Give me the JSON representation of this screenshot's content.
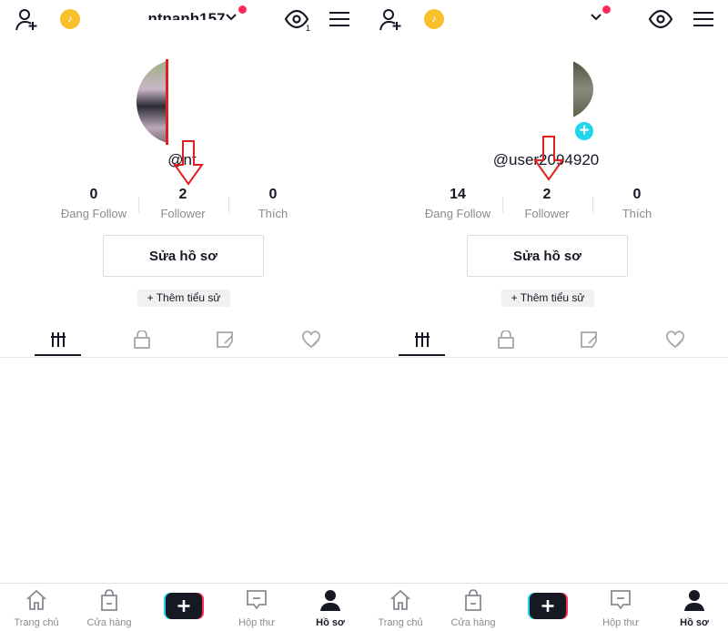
{
  "left_panel": {
    "header": {
      "title": "ntnanh157",
      "eye_badge": "1",
      "has_notification_dot": true
    },
    "username": "@nt",
    "stats": [
      {
        "value": "0",
        "label": "Đang Follow"
      },
      {
        "value": "2",
        "label": "Follower"
      },
      {
        "value": "0",
        "label": "Thích"
      }
    ],
    "edit_profile": "Sửa hồ sơ",
    "add_bio": "+ Thêm tiểu sử"
  },
  "right_panel": {
    "header": {
      "has_notification_dot": true
    },
    "username": "@user2094920",
    "stats": [
      {
        "value": "14",
        "label": "Đang Follow"
      },
      {
        "value": "2",
        "label": "Follower"
      },
      {
        "value": "0",
        "label": "Thích"
      }
    ],
    "edit_profile": "Sửa hồ sơ",
    "add_bio": "+ Thêm tiểu sử"
  },
  "tabs": [
    "videos-grid-icon",
    "lock-icon",
    "tagged-icon",
    "liked-icon"
  ],
  "bottom_nav": [
    {
      "label": "Trang chủ",
      "icon": "home-icon"
    },
    {
      "label": "Cửa hàng",
      "icon": "shop-bag-icon"
    },
    {
      "label": "",
      "icon": "create-plus-icon"
    },
    {
      "label": "Hộp thư",
      "icon": "inbox-icon"
    },
    {
      "label": "Hồ sơ",
      "icon": "profile-icon",
      "active": true
    }
  ],
  "colors": {
    "accent": "#fe2c55",
    "cyan": "#20d5ec",
    "annotation_arrow": "#e02020",
    "coin": "#f8c12c"
  }
}
